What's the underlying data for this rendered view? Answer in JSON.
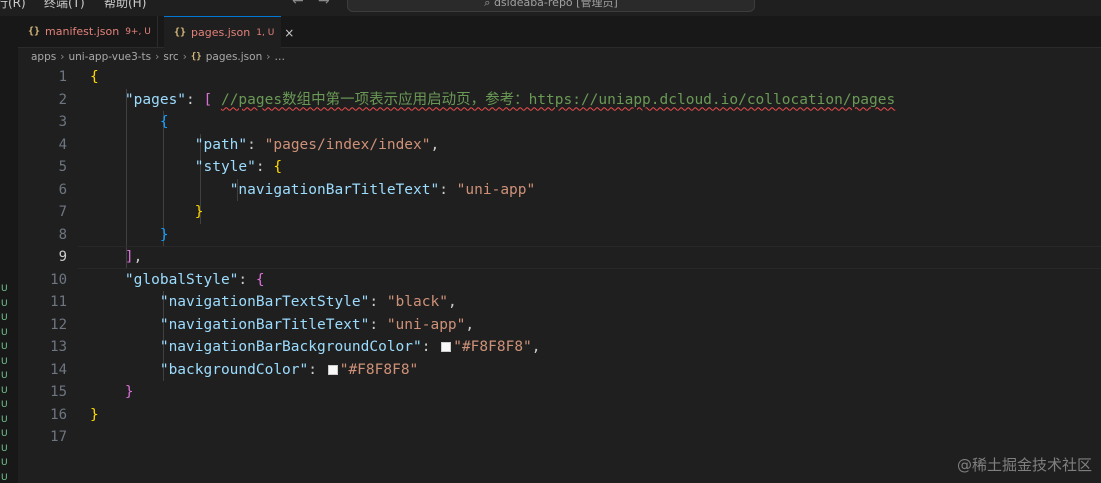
{
  "menu": {
    "item1": "行(R)",
    "item2": "终端(T)",
    "item3": "帮助(H)"
  },
  "command_center": {
    "text": "dsideaba-repo [管理员]"
  },
  "tabs": [
    {
      "icon": "{}",
      "name": "manifest.json",
      "status": "9+, U"
    },
    {
      "icon": "{}",
      "name": "pages.json",
      "status": "1, U",
      "close": "×"
    }
  ],
  "breadcrumb": [
    "apps",
    "uni-app-vue3-ts",
    "src",
    "pages.json",
    "…"
  ],
  "breadcrumb_icon": "{}",
  "sidebar_marks": [
    "U",
    "U",
    "U",
    "U",
    "U",
    "U",
    "U",
    "U",
    "U",
    "U",
    "U",
    "U",
    "U",
    "U"
  ],
  "editor": {
    "active_line": 9,
    "line_numbers": [
      "1",
      "2",
      "3",
      "4",
      "5",
      "6",
      "7",
      "8",
      "9",
      "10",
      "11",
      "12",
      "13",
      "14",
      "15",
      "16",
      "17"
    ],
    "lines": [
      {
        "tokens": [
          {
            "t": "{",
            "c": "b1"
          }
        ]
      },
      {
        "tokens": [
          {
            "t": "    "
          },
          {
            "t": "\"pages\"",
            "c": "k"
          },
          {
            "t": ": "
          },
          {
            "t": "[",
            "c": "b2"
          },
          {
            "t": " "
          },
          {
            "t": "//pages数组中第一项表示应用启动页，参考：https://uniapp.dcloud.io/collocation/pages",
            "c": "c",
            "squig": true
          }
        ]
      },
      {
        "tokens": [
          {
            "t": "        "
          },
          {
            "t": "{",
            "c": "b3"
          }
        ]
      },
      {
        "tokens": [
          {
            "t": "            "
          },
          {
            "t": "\"path\"",
            "c": "k"
          },
          {
            "t": ": "
          },
          {
            "t": "\"pages/index/index\"",
            "c": "s"
          },
          {
            "t": ","
          }
        ]
      },
      {
        "tokens": [
          {
            "t": "            "
          },
          {
            "t": "\"style\"",
            "c": "k"
          },
          {
            "t": ": "
          },
          {
            "t": "{",
            "c": "b1"
          }
        ]
      },
      {
        "tokens": [
          {
            "t": "                "
          },
          {
            "t": "\"navigationBarTitleText\"",
            "c": "k"
          },
          {
            "t": ": "
          },
          {
            "t": "\"uni-app\"",
            "c": "s"
          }
        ]
      },
      {
        "tokens": [
          {
            "t": "            "
          },
          {
            "t": "}",
            "c": "b1"
          }
        ]
      },
      {
        "tokens": [
          {
            "t": "        "
          },
          {
            "t": "}",
            "c": "b3"
          }
        ]
      },
      {
        "tokens": [
          {
            "t": "    "
          },
          {
            "t": "]",
            "c": "b2"
          },
          {
            "t": ","
          }
        ]
      },
      {
        "tokens": [
          {
            "t": "    "
          },
          {
            "t": "\"globalStyle\"",
            "c": "k"
          },
          {
            "t": ": "
          },
          {
            "t": "{",
            "c": "b2"
          }
        ]
      },
      {
        "tokens": [
          {
            "t": "        "
          },
          {
            "t": "\"navigationBarTextStyle\"",
            "c": "k"
          },
          {
            "t": ": "
          },
          {
            "t": "\"black\"",
            "c": "s"
          },
          {
            "t": ","
          }
        ]
      },
      {
        "tokens": [
          {
            "t": "        "
          },
          {
            "t": "\"navigationBarTitleText\"",
            "c": "k"
          },
          {
            "t": ": "
          },
          {
            "t": "\"uni-app\"",
            "c": "s"
          },
          {
            "t": ","
          }
        ]
      },
      {
        "tokens": [
          {
            "t": "        "
          },
          {
            "t": "\"navigationBarBackgroundColor\"",
            "c": "k"
          },
          {
            "t": ": "
          },
          {
            "swatch": "#F8F8F8"
          },
          {
            "t": "\"#F8F8F8\"",
            "c": "s"
          },
          {
            "t": ","
          }
        ]
      },
      {
        "tokens": [
          {
            "t": "        "
          },
          {
            "t": "\"backgroundColor\"",
            "c": "k"
          },
          {
            "t": ": "
          },
          {
            "swatch": "#F8F8F8"
          },
          {
            "t": "\"#F8F8F8\"",
            "c": "s"
          }
        ]
      },
      {
        "tokens": [
          {
            "t": "    "
          },
          {
            "t": "}",
            "c": "b2"
          }
        ]
      },
      {
        "tokens": [
          {
            "t": "}",
            "c": "b1"
          }
        ]
      },
      {
        "tokens": []
      }
    ]
  },
  "watermark": "@稀土掘金技术社区",
  "colors": {
    "accent": "#0078d4",
    "untracked": "#73c991",
    "error": "#f14c4c",
    "swatch": "#F8F8F8"
  }
}
